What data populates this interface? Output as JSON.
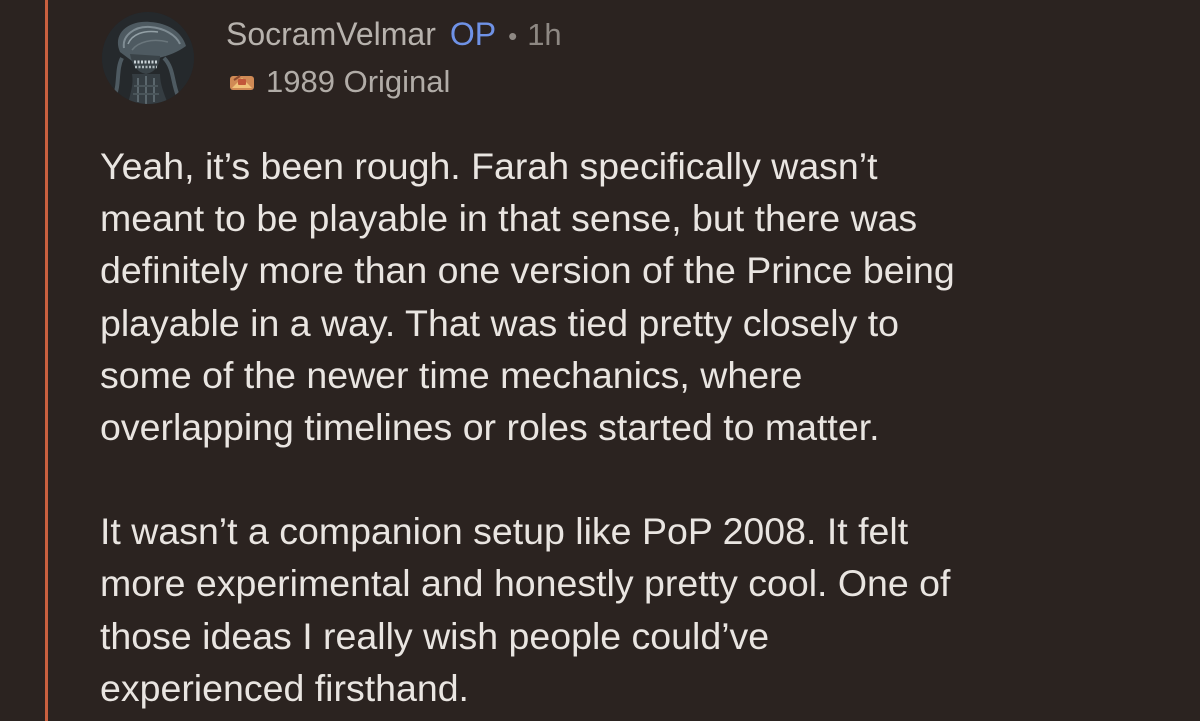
{
  "comment": {
    "author": "SocramVelmar",
    "op_badge": "OP",
    "separator": "•",
    "time": "1h",
    "flair": {
      "icon": "flair-emoji-icon",
      "text": "1989 Original"
    },
    "avatar_icon": "alien-avatar-icon",
    "paragraphs": [
      "Yeah, it’s been rough. Farah specifically wasn’t\nmeant to be playable in that sense, but there was\ndefinitely more than one version of the Prince being\nplayable in a way. That was tied pretty closely to\nsome of the newer time mechanics, where\noverlapping timelines or roles started to matter.",
      "It wasn’t a companion setup like PoP 2008. It felt\nmore experimental and honestly pretty cool. One of\nthose ideas I really wish people could’ve\nexperienced firsthand."
    ]
  },
  "colors": {
    "background": "#2b2320",
    "thread_line": "#c9603f",
    "op_badge": "#6f92e6",
    "body_text": "#e9e5e1",
    "username": "#b7b2ad"
  }
}
